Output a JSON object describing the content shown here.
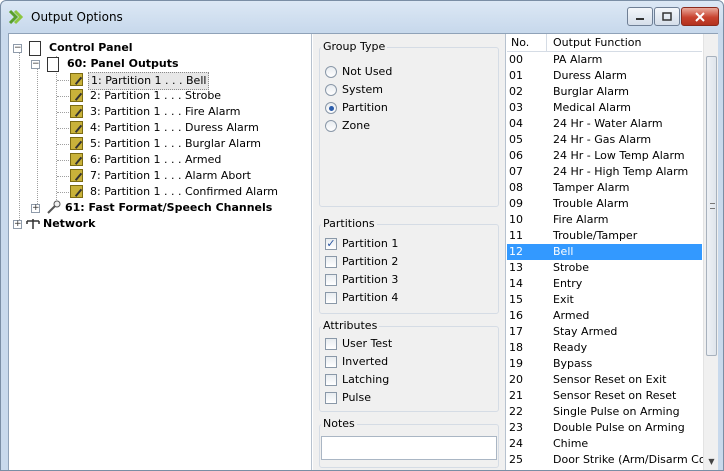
{
  "window": {
    "title": "Output Options"
  },
  "tree": {
    "root": {
      "label": "Control Panel"
    },
    "panel_outputs": {
      "label": "60: Panel Outputs"
    },
    "items": [
      {
        "label": "1: Partition 1 . . . Bell",
        "selected": true
      },
      {
        "label": "2: Partition 1 . . . Strobe"
      },
      {
        "label": "3: Partition 1 . . . Fire Alarm"
      },
      {
        "label": "4: Partition 1 . . . Duress Alarm"
      },
      {
        "label": "5: Partition 1 . . . Burglar Alarm"
      },
      {
        "label": "6: Partition 1 . . . Armed"
      },
      {
        "label": "7: Partition 1 . . . Alarm Abort"
      },
      {
        "label": "8: Partition 1 . . . Confirmed Alarm"
      }
    ],
    "fast_format": {
      "label": "61: Fast Format/Speech Channels"
    },
    "network": {
      "label": "Network"
    }
  },
  "group_type": {
    "label": "Group Type",
    "options": [
      {
        "label": "Not Used",
        "selected": false
      },
      {
        "label": "System",
        "selected": false
      },
      {
        "label": "Partition",
        "selected": true
      },
      {
        "label": "Zone",
        "selected": false
      }
    ]
  },
  "partitions": {
    "label": "Partitions",
    "options": [
      {
        "label": "Partition 1",
        "checked": true
      },
      {
        "label": "Partition 2",
        "checked": false
      },
      {
        "label": "Partition 3",
        "checked": false
      },
      {
        "label": "Partition 4",
        "checked": false
      }
    ]
  },
  "attributes": {
    "label": "Attributes",
    "options": [
      {
        "label": "User Test",
        "checked": false
      },
      {
        "label": "Inverted",
        "checked": false
      },
      {
        "label": "Latching",
        "checked": false
      },
      {
        "label": "Pulse",
        "checked": false
      }
    ]
  },
  "notes": {
    "label": "Notes",
    "value": ""
  },
  "output_list": {
    "headers": {
      "no": "No.",
      "function": "Output Function"
    },
    "selected_no": "12",
    "rows": [
      {
        "no": "00",
        "fn": "PA Alarm"
      },
      {
        "no": "01",
        "fn": "Duress Alarm"
      },
      {
        "no": "02",
        "fn": "Burglar Alarm"
      },
      {
        "no": "03",
        "fn": "Medical Alarm"
      },
      {
        "no": "04",
        "fn": "24 Hr - Water Alarm"
      },
      {
        "no": "05",
        "fn": "24 Hr - Gas Alarm"
      },
      {
        "no": "06",
        "fn": "24 Hr - Low Temp Alarm"
      },
      {
        "no": "07",
        "fn": "24 Hr - High Temp Alarm"
      },
      {
        "no": "08",
        "fn": "Tamper Alarm"
      },
      {
        "no": "09",
        "fn": "Trouble Alarm"
      },
      {
        "no": "10",
        "fn": "Fire Alarm"
      },
      {
        "no": "11",
        "fn": "Trouble/Tamper"
      },
      {
        "no": "12",
        "fn": "Bell"
      },
      {
        "no": "13",
        "fn": "Strobe"
      },
      {
        "no": "14",
        "fn": "Entry"
      },
      {
        "no": "15",
        "fn": "Exit"
      },
      {
        "no": "16",
        "fn": "Armed"
      },
      {
        "no": "17",
        "fn": "Stay Armed"
      },
      {
        "no": "18",
        "fn": "Ready"
      },
      {
        "no": "19",
        "fn": "Bypass"
      },
      {
        "no": "20",
        "fn": "Sensor Reset on Exit"
      },
      {
        "no": "21",
        "fn": "Sensor Reset on Reset"
      },
      {
        "no": "22",
        "fn": "Single Pulse on Arming"
      },
      {
        "no": "23",
        "fn": "Double Pulse on Arming"
      },
      {
        "no": "24",
        "fn": "Chime"
      },
      {
        "no": "25",
        "fn": "Door Strike (Arm/Disarm Code)"
      }
    ]
  },
  "colors": {
    "selection": "#3399ff",
    "titlebar": "#c8d9ec",
    "close_button": "#c8432f"
  }
}
